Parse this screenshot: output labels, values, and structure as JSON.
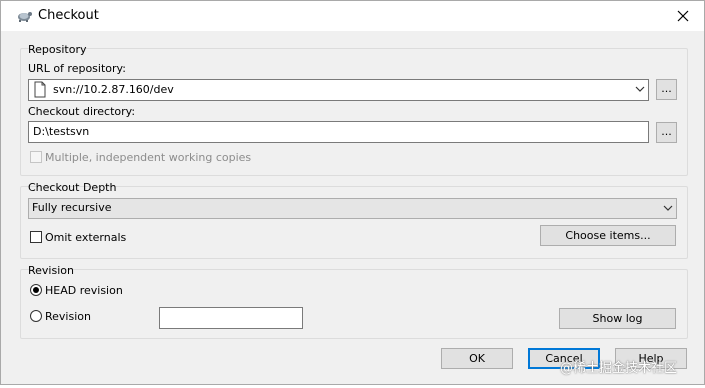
{
  "window": {
    "title": "Checkout",
    "app_icon": "tortoisesvn-icon",
    "close_icon": "close-icon"
  },
  "repository": {
    "group_label": "Repository",
    "url_label": "URL of repository:",
    "url_value": "svn://10.2.87.160/dev",
    "url_browse": "...",
    "dir_label": "Checkout directory:",
    "dir_value": "D:\\testsvn",
    "dir_browse": "...",
    "multiple_label": "Multiple, independent working copies",
    "multiple_checked": false,
    "multiple_enabled": false
  },
  "depth": {
    "group_label": "Checkout Depth",
    "selected": "Fully recursive",
    "omit_externals_label": "Omit externals",
    "omit_externals_checked": false,
    "choose_items": "Choose items..."
  },
  "revision": {
    "group_label": "Revision",
    "head_label": "HEAD revision",
    "head_selected": true,
    "revision_label": "Revision",
    "revision_value": "",
    "show_log": "Show log"
  },
  "buttons": {
    "ok": "OK",
    "cancel": "Cancel",
    "help": "Help"
  },
  "watermark": "@稀土掘金技术社区",
  "colors": {
    "accent": "#0078d7",
    "dialog_bg": "#f0f0f0",
    "titlebar_bg": "#ffffff"
  }
}
